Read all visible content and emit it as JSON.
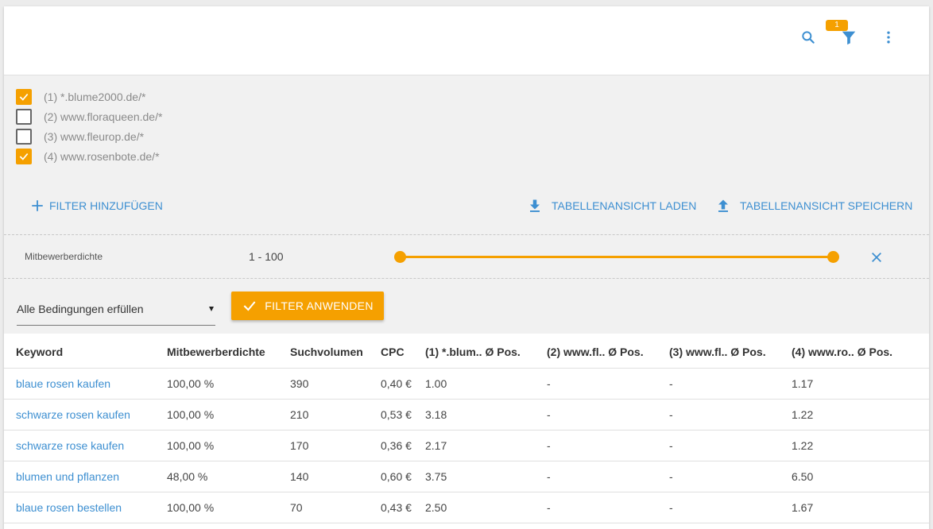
{
  "toolbar": {
    "filter_badge": "1"
  },
  "domains": [
    {
      "label": "(1) *.blume2000.de/*",
      "checked": true
    },
    {
      "label": "(2) www.floraqueen.de/*",
      "checked": false
    },
    {
      "label": "(3) www.fleurop.de/*",
      "checked": false
    },
    {
      "label": "(4) www.rosenbote.de/*",
      "checked": true
    }
  ],
  "actions": {
    "add_filter": "FILTER HINZUFÜGEN",
    "load_view": "TABELLENANSICHT LADEN",
    "save_view": "TABELLENANSICHT SPEICHERN"
  },
  "filter": {
    "label": "Mitbewerberdichte",
    "range_text": "1 - 100",
    "range_min": 1,
    "range_max": 100
  },
  "condition": {
    "value": "Alle Bedingungen erfüllen",
    "apply_label": "FILTER ANWENDEN"
  },
  "colors": {
    "accent": "#f5a000",
    "link": "#3d8fd1"
  },
  "table": {
    "headers": [
      "Keyword",
      "Mitbewerberdichte",
      "Suchvolumen",
      "CPC",
      "(1) *.blum.. Ø Pos.",
      "(2) www.fl.. Ø Pos.",
      "(3) www.fl.. Ø Pos.",
      "(4) www.ro.. Ø Pos."
    ],
    "rows": [
      [
        "blaue rosen kaufen",
        "100,00 %",
        "390",
        "0,40 €",
        "1.00",
        "-",
        "-",
        "1.17"
      ],
      [
        "schwarze rosen kaufen",
        "100,00 %",
        "210",
        "0,53 €",
        "3.18",
        "-",
        "-",
        "1.22"
      ],
      [
        "schwarze rose kaufen",
        "100,00 %",
        "170",
        "0,36 €",
        "2.17",
        "-",
        "-",
        "1.22"
      ],
      [
        "blumen und pflanzen",
        "48,00 %",
        "140",
        "0,60 €",
        "3.75",
        "-",
        "-",
        "6.50"
      ],
      [
        "blaue rosen bestellen",
        "100,00 %",
        "70",
        "0,43 €",
        "2.50",
        "-",
        "-",
        "1.67"
      ]
    ]
  }
}
